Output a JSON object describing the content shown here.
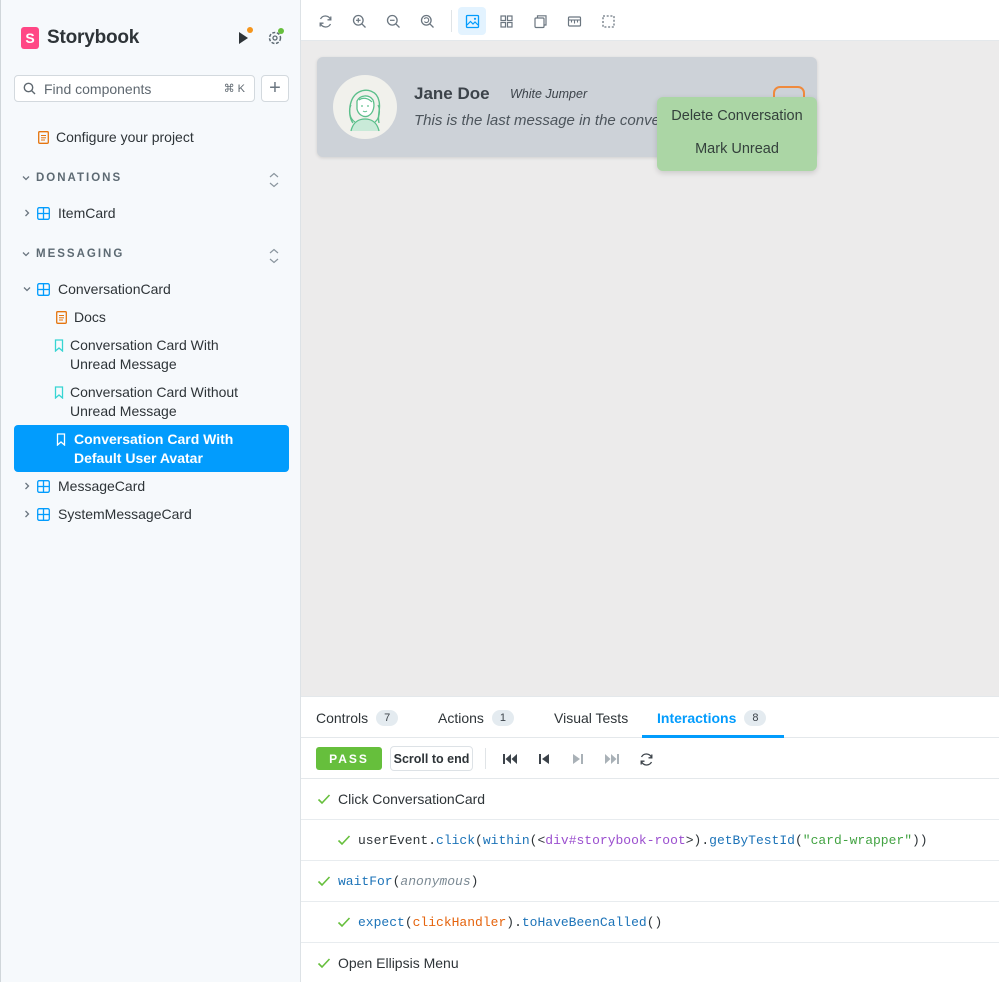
{
  "sidebar": {
    "brand": "Storybook",
    "search": {
      "placeholder": "Find components",
      "shortcut": "⌘ K"
    },
    "add_label": "+",
    "configure": "Configure your project",
    "sections": [
      {
        "title": "DONATIONS"
      },
      {
        "title": "MESSAGING"
      }
    ],
    "items": {
      "item_card": "ItemCard",
      "conversation_card": "ConversationCard",
      "docs": "Docs",
      "story_unread": "Conversation Card With Unread Message",
      "story_no_unread": "Conversation Card Without Unread Message",
      "story_default_avatar": "Conversation Card With Default User Avatar",
      "message_card": "MessageCard",
      "system_message_card": "SystemMessageCard"
    }
  },
  "preview": {
    "card": {
      "name": "Jane Doe",
      "tag": "White Jumper",
      "message": "This is the last message in the conversation"
    },
    "menu": [
      "Delete Conversation",
      "Mark Unread"
    ]
  },
  "addons": {
    "tabs": [
      {
        "label": "Controls",
        "count": "7"
      },
      {
        "label": "Actions",
        "count": "1"
      },
      {
        "label": "Visual Tests",
        "count": ""
      },
      {
        "label": "Interactions",
        "count": "8"
      }
    ],
    "status": "PASS",
    "scroll_button": "Scroll to end",
    "steps": {
      "click_card": "Click ConversationCard",
      "open_menu": "Open Ellipsis Menu",
      "user_event": {
        "obj": "userEvent",
        "dot1": ".",
        "method": "click",
        "open": "(",
        "within": "within",
        "lt": "(<",
        "tag": "div",
        "root_id": "#storybook-root",
        "gt": ">)",
        "dot2": ".",
        "get_by": "getByTestId",
        "open2": "(",
        "test_id": "\"card-wrapper\"",
        "close": "))"
      },
      "wait_for": {
        "fn": "waitFor",
        "open": "(",
        "arg": "anonymous",
        "close": ")"
      },
      "expect": {
        "fn": "expect",
        "open": "(",
        "arg": "clickHandler",
        "close": ")",
        "dot": ".",
        "method": "toHaveBeenCalled",
        "call": "()"
      }
    }
  },
  "colors": {
    "accent": "#029cfd",
    "brand": "#ff4785",
    "pass": "#66bf3c",
    "menu": "#abd6a5",
    "ellipsis_border": "#ef8a3d"
  }
}
